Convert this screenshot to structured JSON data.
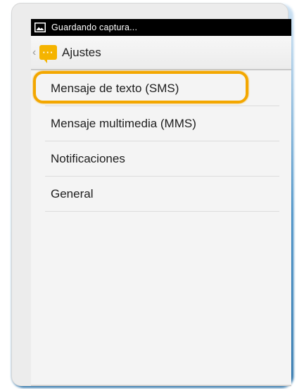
{
  "status_bar": {
    "text": "Guardando captura...",
    "icon": "image-icon"
  },
  "action_bar": {
    "back_icon": "chevron-left-icon",
    "app_icon": "messaging-icon",
    "title": "Ajustes"
  },
  "settings": {
    "items": [
      {
        "label": "Mensaje de texto (SMS)"
      },
      {
        "label": "Mensaje multimedia (MMS)"
      },
      {
        "label": "Notificaciones"
      },
      {
        "label": "General"
      }
    ]
  },
  "colors": {
    "highlight": "#f3a700",
    "app_icon": "#f5b400",
    "status_bar": "#000000"
  }
}
